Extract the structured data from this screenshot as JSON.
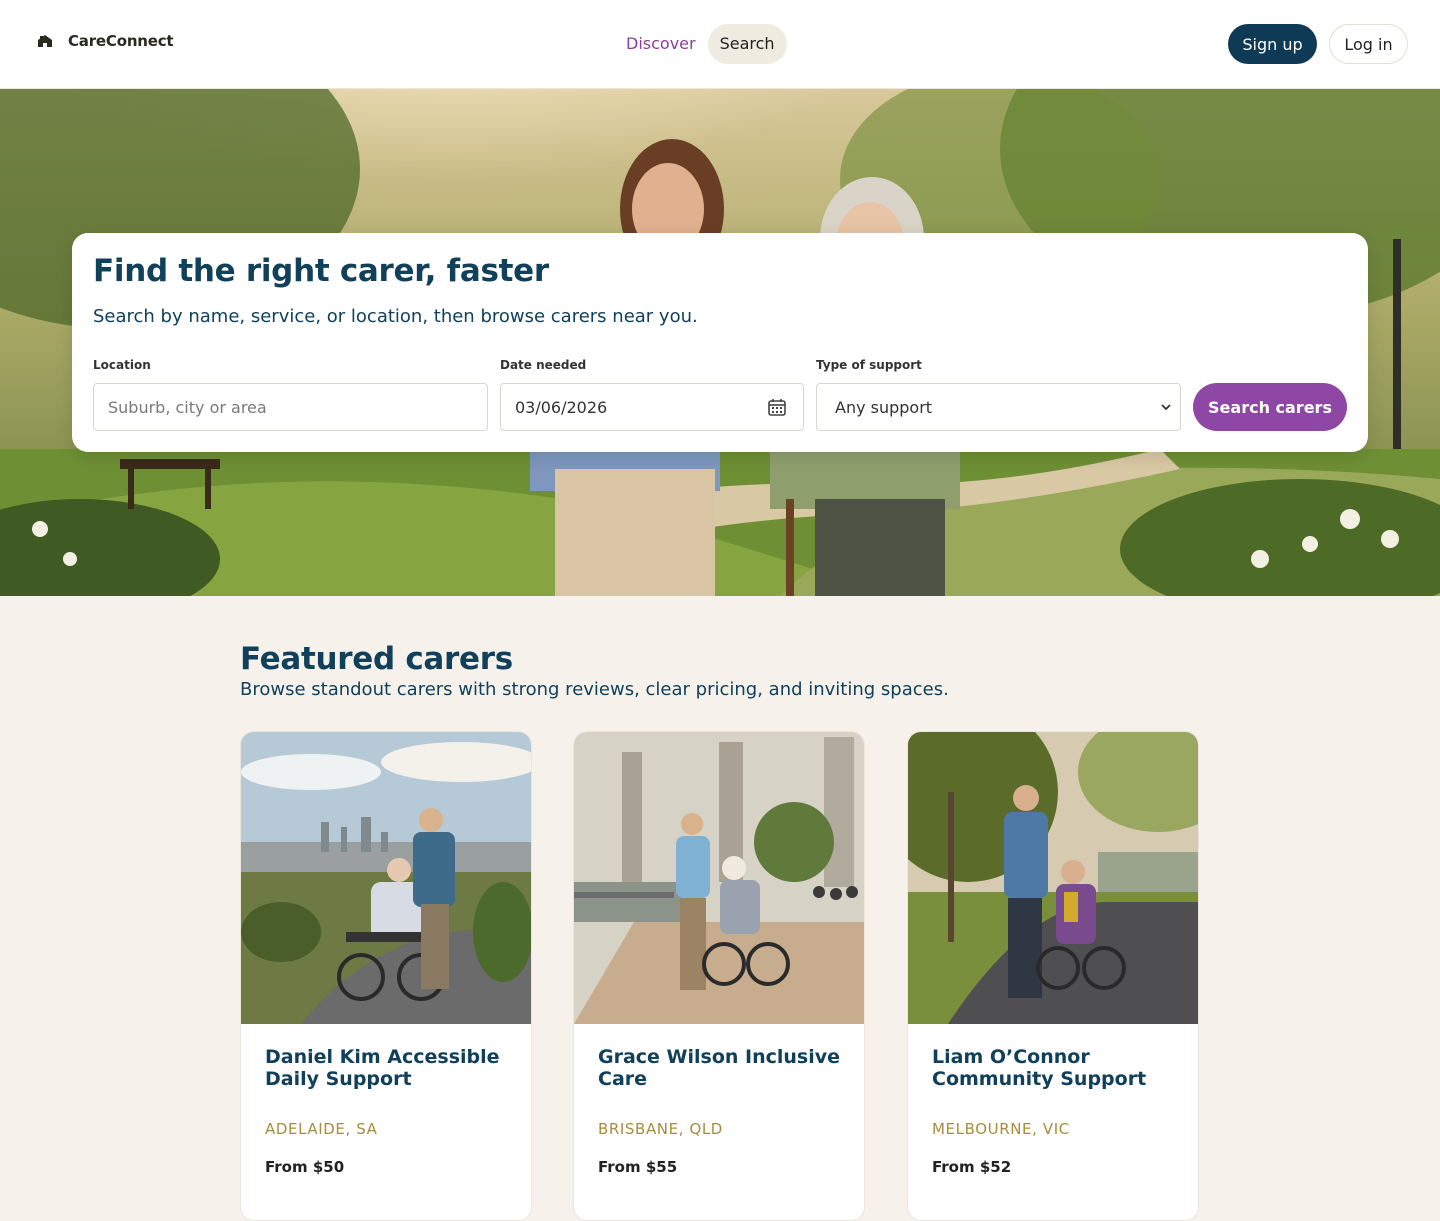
{
  "brand": {
    "name": "CareConnect",
    "icon": "home-icon"
  },
  "nav": {
    "discover": "Discover",
    "search": "Search"
  },
  "auth": {
    "signup": "Sign up",
    "login": "Log in"
  },
  "hero": {
    "title": "Find the right carer, faster",
    "subtitle": "Search by name, service, or location, then browse carers near you.",
    "location_label": "Location",
    "location_placeholder": "Suburb, city or area",
    "date_label": "Date needed",
    "date_value": "03/06/2026",
    "support_label": "Type of support",
    "support_value": "Any support",
    "search_button": "Search carers"
  },
  "featured": {
    "title": "Featured carers",
    "subtitle": "Browse standout carers with strong reviews, clear pricing, and inviting spaces.",
    "cards": [
      {
        "name": "Daniel Kim Accessible Daily Support",
        "location": "ADELAIDE, SA",
        "price": "From $50"
      },
      {
        "name": "Grace Wilson Inclusive Care",
        "location": "BRISBANE, QLD",
        "price": "From $55"
      },
      {
        "name": "Liam O’Connor Community Support",
        "location": "MELBOURNE, VIC",
        "price": "From $52"
      }
    ]
  },
  "colors": {
    "brand_navy": "#0f3a56",
    "accent_purple": "#8f47a6",
    "location_gold": "#a88c3e",
    "page_bg": "#f6f2eb"
  }
}
